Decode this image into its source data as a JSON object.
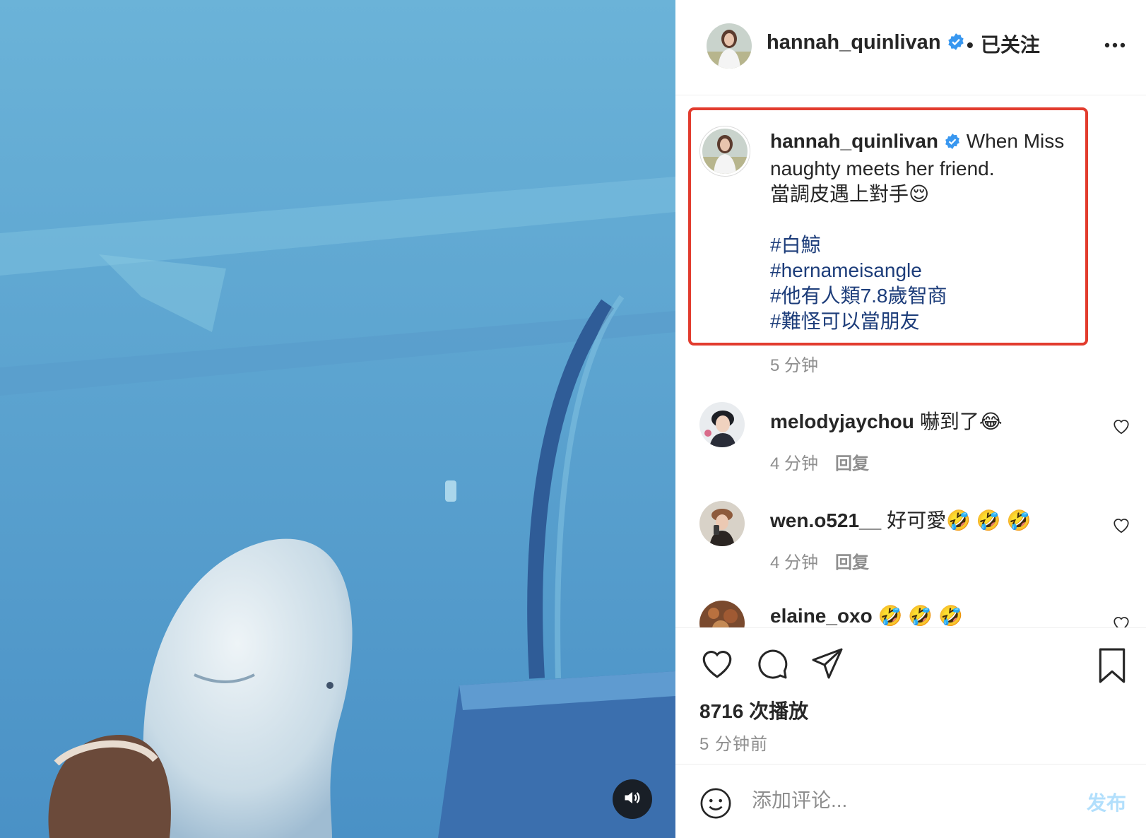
{
  "post": {
    "author": "hannah_quinlivan",
    "follow_status": "已关注",
    "caption": {
      "username": "hannah_quinlivan",
      "line1": " When Miss naughty meets her friend.",
      "line2": "當調皮遇上對手😌",
      "tags": [
        "#白鯨",
        "#hernameisangle",
        "#他有人類7.8歲智商",
        "#難怪可以當朋友"
      ]
    },
    "caption_time": "5 分钟"
  },
  "comments": [
    {
      "username": "melodyjaychou",
      "text": "嚇到了😂",
      "time": "4 分钟",
      "reply": "回复"
    },
    {
      "username": "wen.o521__",
      "text": "好可愛🤣 🤣 🤣",
      "time": "4 分钟",
      "reply": "回复"
    },
    {
      "username": "elaine_oxo",
      "text": "🤣 🤣 🤣"
    }
  ],
  "stats": {
    "views": "8716 次播放",
    "posted": "5 分钟前"
  },
  "comment_bar": {
    "placeholder": "添加评论...",
    "post_label": "发布"
  },
  "icons": {
    "verified": "verified-badge-icon",
    "more": "more-options-icon",
    "like": "heart-icon",
    "comment": "comment-bubble-icon",
    "share": "share-paper-plane-icon",
    "save": "bookmark-icon",
    "emoji": "smiley-face-icon",
    "sound": "speaker-icon"
  },
  "colors": {
    "highlight": "#e23c2e",
    "hashtag": "#1d3d7a",
    "verified": "#3897f0",
    "post_button": "#b2dffc"
  }
}
